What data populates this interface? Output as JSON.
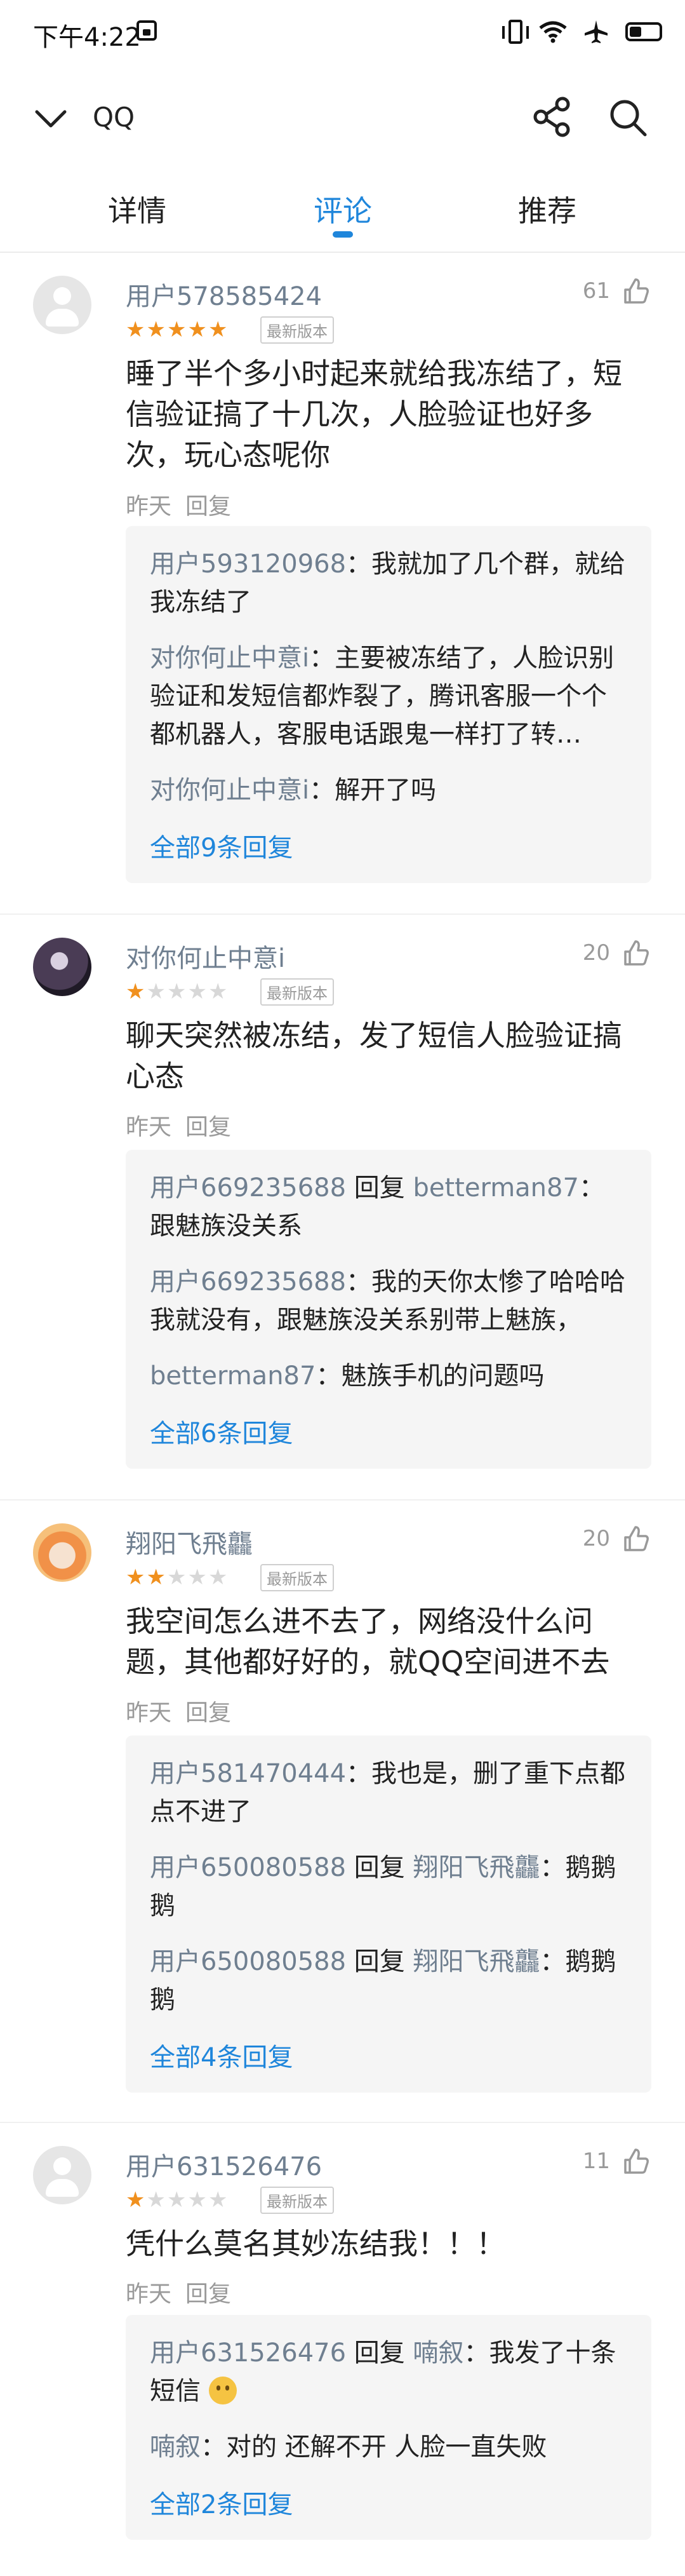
{
  "status_bar": {
    "time": "下午4:22"
  },
  "header": {
    "title": "QQ"
  },
  "tabs": [
    {
      "label": "详情"
    },
    {
      "label": "评论"
    },
    {
      "label": "推荐"
    }
  ],
  "colors": {
    "accent": "#1f86db",
    "star": "#f0901e",
    "username": "#6f7f90"
  },
  "comments": [
    {
      "user": "用户578585424",
      "likes": "61",
      "rating": 5,
      "badge": "最新版本",
      "text": "睡了半个多小时起来就给我冻结了，短信验证搞了十几次，人脸验证也好多次，玩心态呢你",
      "time": "昨天",
      "reply_label": "回复",
      "replies": [
        {
          "user": "用户593120968",
          "sep": "：",
          "text": "我就加了几个群，就给我冻结了"
        },
        {
          "user": "对你何止中意i",
          "sep": "：",
          "text": "主要被冻结了，人脸识别验证和发短信都炸裂了，腾讯客服一个个都机器人，客服电话跟鬼一样打了转…"
        },
        {
          "user": "对你何止中意i",
          "sep": "：",
          "text": "解开了吗"
        }
      ],
      "all_replies": "全部9条回复"
    },
    {
      "user": "对你何止中意i",
      "likes": "20",
      "rating": 1,
      "badge": "最新版本",
      "text": "聊天突然被冻结，发了短信人脸验证搞心态",
      "time": "昨天",
      "reply_label": "回复",
      "replies": [
        {
          "user": "用户669235688",
          "mid": " 回复 ",
          "user2": "betterman87",
          "sep": "：",
          "text": "跟魅族没关系"
        },
        {
          "user": "用户669235688",
          "sep": "：",
          "text": "我的天你太惨了哈哈哈我就没有，跟魅族没关系别带上魅族，"
        },
        {
          "user": "betterman87",
          "sep": "：",
          "text": "魅族手机的问题吗"
        }
      ],
      "all_replies": "全部6条回复"
    },
    {
      "user": "翔阳飞飛龘",
      "likes": "20",
      "rating": 2,
      "badge": "最新版本",
      "text": "我空间怎么进不去了，网络没什么问题，其他都好好的，就QQ空间进不去",
      "time": "昨天",
      "reply_label": "回复",
      "replies": [
        {
          "user": "用户581470444",
          "sep": "：",
          "text": "我也是，删了重下点都点不进了"
        },
        {
          "user": "用户650080588",
          "mid": " 回复 ",
          "user2": "翔阳飞飛龘",
          "sep": "：",
          "text": "鹅鹅鹅"
        },
        {
          "user": "用户650080588",
          "mid": " 回复 ",
          "user2": "翔阳飞飛龘",
          "sep": "：",
          "text": "鹅鹅鹅"
        }
      ],
      "all_replies": "全部4条回复"
    },
    {
      "user": "用户631526476",
      "likes": "11",
      "rating": 1,
      "badge": "最新版本",
      "text": "凭什么莫名其妙冻结我！！！",
      "time": "昨天",
      "reply_label": "回复",
      "replies": [
        {
          "user": "用户631526476",
          "mid": " 回复 ",
          "user2": "喃叙",
          "sep": "：",
          "text": "我发了十条短信"
        },
        {
          "user": "喃叙",
          "sep": "：",
          "text": "对的 还解不开 人脸一直失败"
        }
      ],
      "all_replies": "全部2条回复"
    }
  ]
}
